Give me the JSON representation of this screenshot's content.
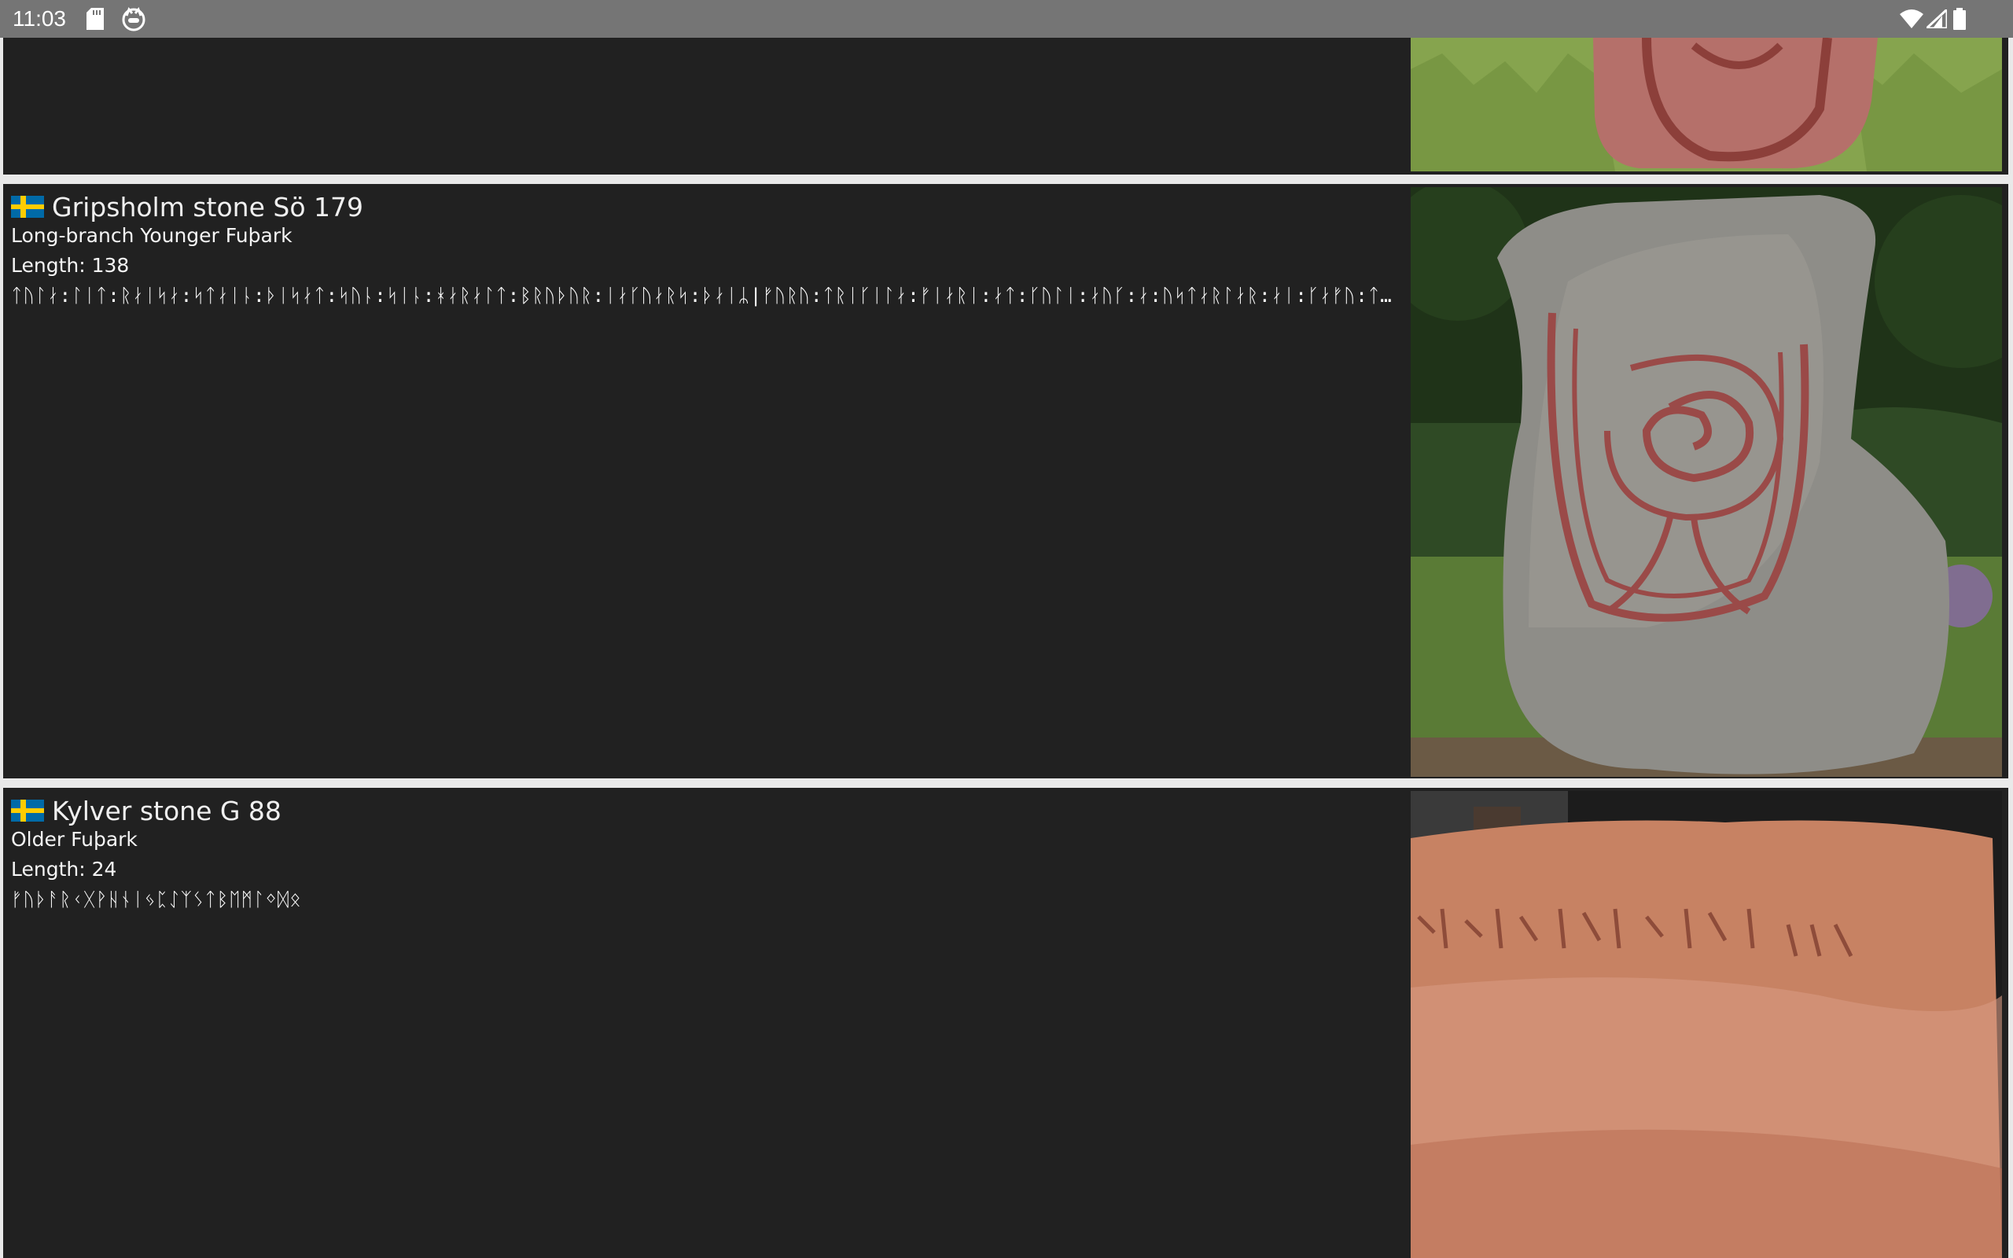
{
  "status_bar": {
    "time": "11:03",
    "icons": [
      "sd-card-icon",
      "cat-icon",
      "wifi-icon",
      "signal-icon",
      "battery-icon"
    ]
  },
  "cards": [
    {
      "title": "",
      "country_flag": "sweden-flag",
      "image": "rune stone photo (partially visible)"
    },
    {
      "title": "Gripsholm stone Sö 179",
      "country_flag": "sweden-flag",
      "script": "Long-branch Younger Fuþark",
      "length_text": "Length: 138",
      "runes": "ᛏᚢᛚᛅ:ᛚᛁᛏ:ᚱᛅᛁᛋᛅ:ᛋᛏᛅᛁᚿ:ᚦᛁᛋᛅᛏ:ᛋᚢᚿ:ᛋᛁᚿ:ᚼᛅᚱᛅᛚᛏ:ᛒᚱᚢᚦᚢᚱ:ᛁᛅᚴᚢᛅᚱᛋ:ᚦᛅᛁᛦ|ᚠᚢᚱᚢ:ᛏᚱᛁᚴᛁᛚᛅ:ᚠᛁᛅᚱᛁ:ᛅᛏ:ᚴᚢᛚᛁ:ᛅᚢᚴ:ᛅ:ᚢᛋᛏᛅᚱᛚᛅᚱ:ᛅᛁ:ᚴᛅᚠᚢ:ᛏᚢᚢ:ᛋᚢᚿᛅᚱ:ᛚᛅ:ᛅᛋᛁᚱᚴ:ᛚ…"
    },
    {
      "title": "Kylver stone G 88",
      "country_flag": "sweden-flag",
      "script": "Older Fuþark",
      "length_text": "Length: 24",
      "runes": "ᚠᚢᚦᚨᚱᚲᚷᚹᚺᚾᛁᛃᛈᛇᛉᛊᛏᛒᛖᛗᛚᛜᛞᛟ"
    }
  ],
  "colors": {
    "status_bar": "#757575",
    "card_bg": "#212121",
    "page_bg": "#e9e9e9",
    "flag_blue": "#006aa7",
    "flag_yellow": "#fecc00"
  }
}
